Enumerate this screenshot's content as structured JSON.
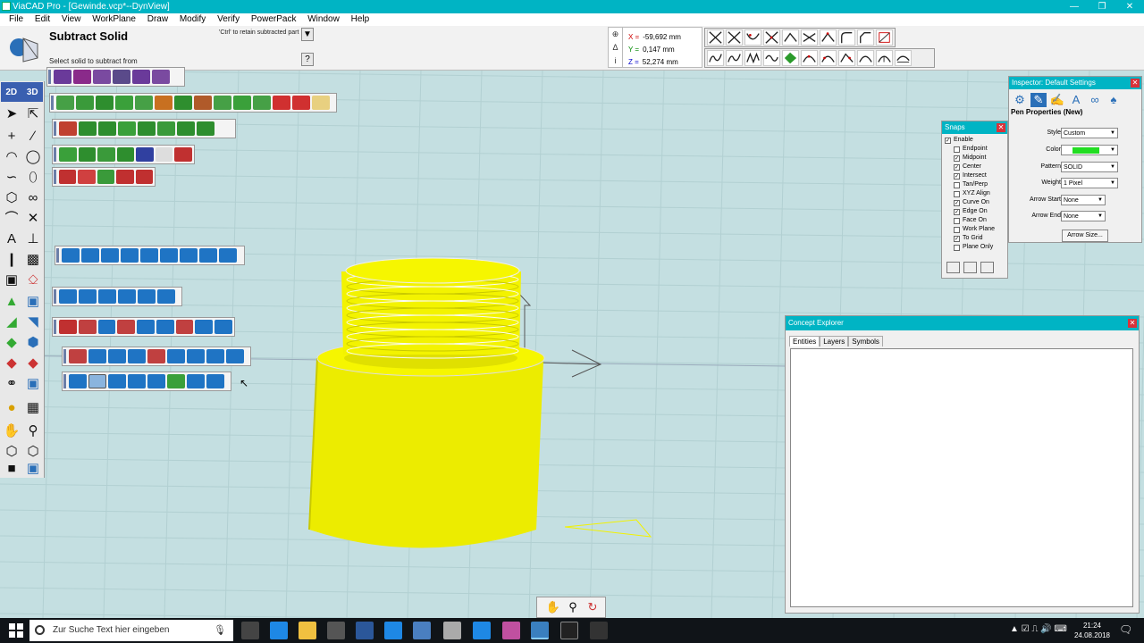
{
  "window": {
    "title": "ViaCAD Pro - [Gewinde.vcp*--DynView]",
    "minimize_icon": "minimize-icon",
    "restore_icon": "restore-icon",
    "close_icon": "close-icon"
  },
  "menu": [
    "File",
    "Edit",
    "View",
    "WorkPlane",
    "Draw",
    "Modify",
    "Verify",
    "PowerPack",
    "Window",
    "Help"
  ],
  "propbar": {
    "tool_name": "Subtract Solid",
    "hint": "Select solid to subtract from",
    "ctrl_hint": "'Ctrl' to retain subtracted part",
    "more_btn": "?"
  },
  "coords": {
    "x_label": "X =",
    "x_value": "-59,692 mm",
    "y_label": "Y =",
    "y_value": "0,147 mm",
    "z_label": "Z =",
    "z_value": "52,274 mm"
  },
  "left_palette": {
    "tab_2d": "2D",
    "tab_3d": "3D",
    "text_tool": "A"
  },
  "inspector": {
    "title": "Inspector: Default Settings",
    "section": "Pen Properties (New)",
    "style_label": "Style",
    "style_value": "Custom",
    "color_label": "Color",
    "color_value": "#22dd22",
    "pattern_label": "Pattern",
    "pattern_value": "SOLID",
    "weight_label": "Weight",
    "weight_value": "1 Pixel",
    "arrow_start_label": "Arrow Start",
    "arrow_start_value": "None",
    "arrow_end_label": "Arrow End",
    "arrow_end_value": "None",
    "arrow_size_btn": "Arrow Size..."
  },
  "snaps": {
    "title": "Snaps",
    "items": [
      {
        "label": "Enable",
        "checked": true
      },
      {
        "label": "Endpoint",
        "checked": false
      },
      {
        "label": "Midpoint",
        "checked": true
      },
      {
        "label": "Center",
        "checked": true
      },
      {
        "label": "Intersect",
        "checked": true
      },
      {
        "label": "Tan/Perp",
        "checked": false
      },
      {
        "label": "XYZ Align",
        "checked": false
      },
      {
        "label": "Curve On",
        "checked": true
      },
      {
        "label": "Edge On",
        "checked": true
      },
      {
        "label": "Face On",
        "checked": false
      },
      {
        "label": "Work Plane",
        "checked": false
      },
      {
        "label": "To Grid",
        "checked": true
      },
      {
        "label": "Plane Only",
        "checked": false
      }
    ]
  },
  "explorer": {
    "title": "Concept Explorer",
    "tabs": [
      "Entities",
      "Layers",
      "Symbols"
    ]
  },
  "taskbar": {
    "search_placeholder": "Zur Suche Text hier eingeben",
    "time": "21:24",
    "date": "24.08.2018"
  },
  "colors": {
    "titlebar": "#00b4c4",
    "solid": "#f2f200",
    "viewport_bg": "#c4dfe1",
    "snap_color": "#22dd22"
  }
}
